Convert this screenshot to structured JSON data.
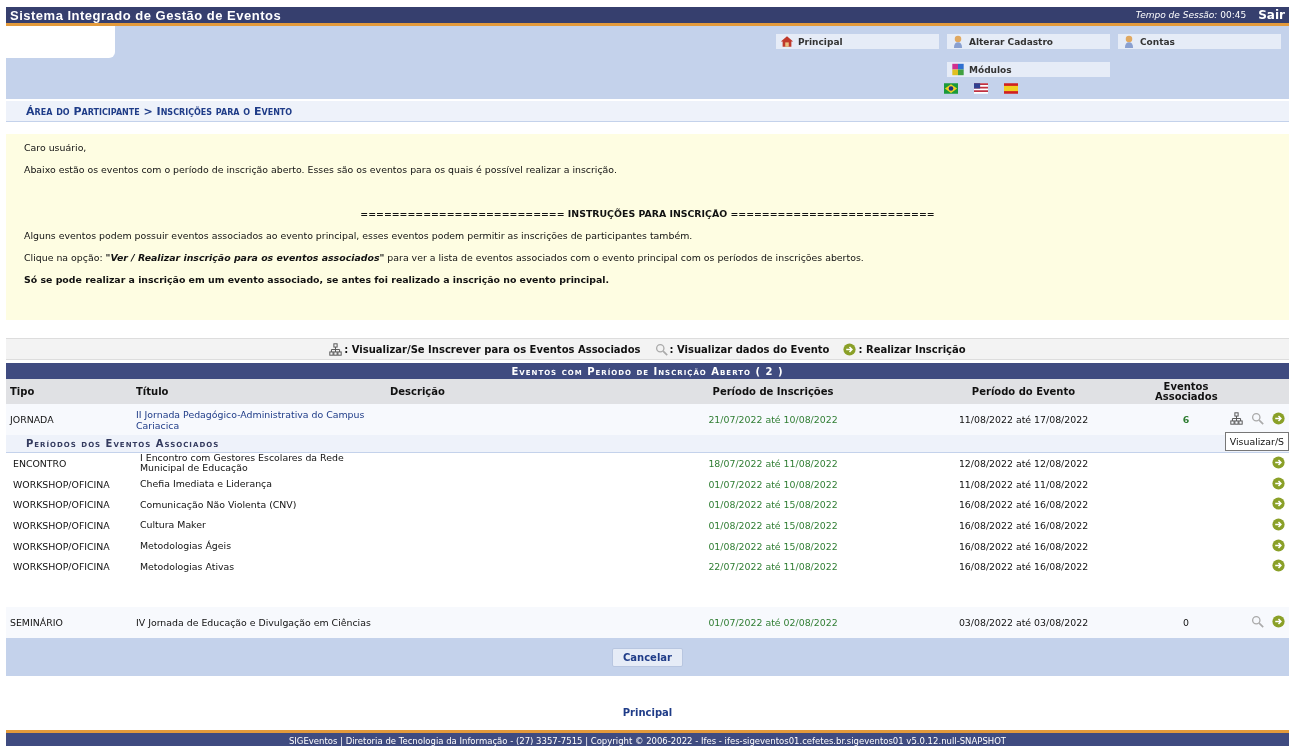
{
  "header": {
    "title": "Sistema Integrado de Gestão de Eventos",
    "session_label": "Tempo de Sessão:",
    "session_time": "00:45",
    "logout": "Sair"
  },
  "menu": [
    {
      "label": "Principal",
      "kind": "home"
    },
    {
      "label": "Alterar Cadastro",
      "kind": "person"
    },
    {
      "label": "Contas",
      "kind": "person"
    },
    {
      "label": "Módulos",
      "kind": "puzzle"
    }
  ],
  "flags": [
    {
      "kind": "br"
    },
    {
      "kind": "us"
    },
    {
      "kind": "es"
    }
  ],
  "breadcrumb": "Área do Participante > Inscrições para o Evento",
  "notice": [
    {
      "kind": "plain",
      "text": "Caro usuário,"
    },
    {
      "kind": "plain",
      "text": "Abaixo estão os eventos com o período de inscrição aberto. Esses são os eventos para os quais é possível realizar a inscrição."
    },
    {
      "kind": "gap"
    },
    {
      "kind": "heading",
      "text": "========================== INSTRUÇÕES PARA INSCRIÇÃO =========================="
    },
    {
      "kind": "plain",
      "text": "Alguns eventos podem possuir eventos associados ao evento principal, esses eventos podem permitir as inscrições de participantes também."
    },
    {
      "kind": "plain",
      "text": "Clique na opção: **\"Ver / Realizar inscrição para os eventos associados\"** para ver a lista de eventos associados com o evento principal com os períodos de inscrições abertos."
    },
    {
      "kind": "bold",
      "text": "Só se pode realizar a inscrição em um evento associado, se antes foi realizado a inscrição no evento principal."
    }
  ],
  "legend": [
    {
      "kind": "tree",
      "label": ": Visualizar/Se Inscrever para os Eventos Associados"
    },
    {
      "kind": "view",
      "label": ": Visualizar dados do Evento"
    },
    {
      "kind": "enroll",
      "label": ": Realizar Inscrição"
    }
  ],
  "table": {
    "caption": "Eventos com Período de Inscrição Aberto ( 2 )",
    "columns": [
      "Tipo",
      "Título",
      "Descrição",
      "Período de Inscrições",
      "Período do Evento",
      "Eventos Associados"
    ],
    "rows": [
      {
        "type": "JORNADA",
        "title": "II Jornada Pedagógico-Administrativa do Campus Cariacica",
        "registration": "21/07/2022 até 10/08/2022",
        "period": "11/08/2022 até 17/08/2022",
        "link": true,
        "associated_count": "6",
        "actions": [
          {
            "kind": "tree"
          },
          {
            "kind": "view"
          },
          {
            "kind": "enroll"
          }
        ],
        "tooltip": "Visualizar/S",
        "associated_heading": "Períodos dos Eventos Associados",
        "associated": [
          {
            "type": "ENCONTRO",
            "title": "I Encontro com Gestores Escolares da Rede Municipal de Educação",
            "registration": "18/07/2022 até 11/08/2022",
            "period": "12/08/2022 até 12/08/2022"
          },
          {
            "type": "WORKSHOP/OFICINA",
            "title": "Chefia Imediata e Liderança",
            "registration": "01/07/2022 até 10/08/2022",
            "period": "11/08/2022 até 11/08/2022"
          },
          {
            "type": "WORKSHOP/OFICINA",
            "title": "Comunicação Não Violenta (CNV)",
            "registration": "01/08/2022 até 15/08/2022",
            "period": "16/08/2022 até 16/08/2022"
          },
          {
            "type": "WORKSHOP/OFICINA",
            "title": "Cultura Maker",
            "registration": "01/08/2022 até 15/08/2022",
            "period": "16/08/2022 até 16/08/2022"
          },
          {
            "type": "WORKSHOP/OFICINA",
            "title": "Metodologias Ágeis",
            "registration": "01/08/2022 até 15/08/2022",
            "period": "16/08/2022 até 16/08/2022"
          },
          {
            "type": "WORKSHOP/OFICINA",
            "title": "Metodologias Ativas",
            "registration": "22/07/2022 até 11/08/2022",
            "period": "16/08/2022 até 16/08/2022"
          }
        ]
      },
      {
        "type": "SEMINÁRIO",
        "title": "IV Jornada de Educação e Divulgação em Ciências",
        "registration": "01/07/2022 até 02/08/2022",
        "period": "03/08/2022 até 03/08/2022",
        "link": false,
        "associated_count": "0",
        "actions": [
          {
            "kind": "view"
          },
          {
            "kind": "enroll"
          }
        ]
      }
    ],
    "cancel": "Cancelar"
  },
  "bottom_link": "Principal",
  "footer": "SIGEventos | Diretoria de Tecnologia da Informação - (27) 3357-7515 | Copyright © 2006-2022 - Ifes - ifes-sigeventos01.cefetes.br.sigeventos01 v5.0.12.null-SNAPSHOT"
}
